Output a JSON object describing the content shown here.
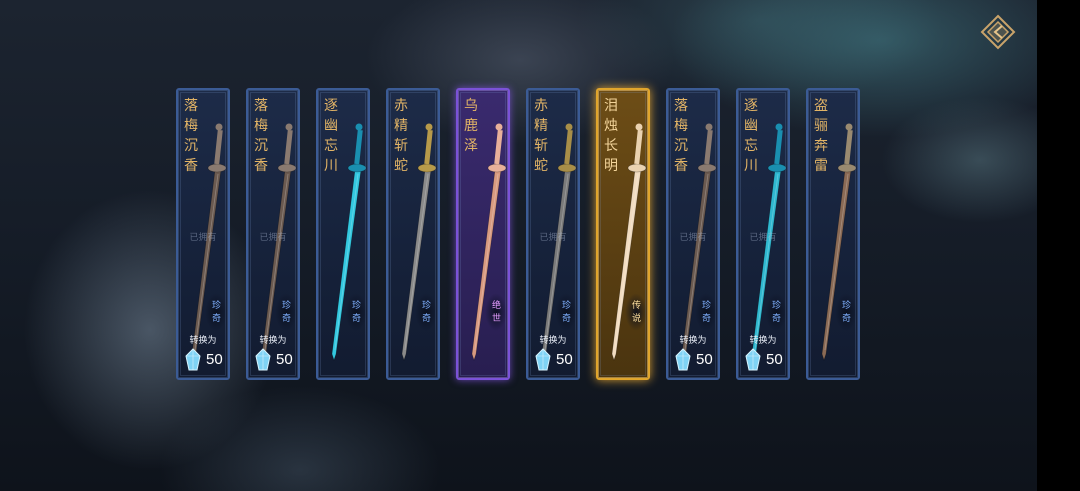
{
  "cards": [
    {
      "name": "落梅沉香",
      "owned": "已拥有",
      "rarity": "珍奇",
      "convert": "转换为",
      "cost": "50",
      "tier": "rare",
      "blade": "#6b5a50",
      "hilt": "#8a7a70"
    },
    {
      "name": "落梅沉香",
      "owned": "已拥有",
      "rarity": "珍奇",
      "convert": "转换为",
      "cost": "50",
      "tier": "rare",
      "blade": "#6b5a50",
      "hilt": "#8a7a70"
    },
    {
      "name": "逐幽忘川",
      "owned": "",
      "rarity": "珍奇",
      "convert": "",
      "cost": "",
      "tier": "rare",
      "blade": "#33c8e0",
      "hilt": "#1a8fb0"
    },
    {
      "name": "赤精斩蛇",
      "owned": "",
      "rarity": "珍奇",
      "convert": "",
      "cost": "",
      "tier": "rare",
      "blade": "#8a8a8a",
      "hilt": "#b79a4a"
    },
    {
      "name": "乌鹿泽",
      "owned": "",
      "rarity": "绝世",
      "convert": "",
      "cost": "",
      "tier": "epic",
      "blade": "#d89a80",
      "hilt": "#e8b09a"
    },
    {
      "name": "赤精斩蛇",
      "owned": "已拥有",
      "rarity": "珍奇",
      "convert": "转换为",
      "cost": "50",
      "tier": "rare",
      "blade": "#7a7a7a",
      "hilt": "#a88e48"
    },
    {
      "name": "泪烛长明",
      "owned": "",
      "rarity": "传说",
      "convert": "",
      "cost": "",
      "tier": "legend",
      "blade": "#f2dcc0",
      "hilt": "#ead2b0"
    },
    {
      "name": "落梅沉香",
      "owned": "已拥有",
      "rarity": "珍奇",
      "convert": "转换为",
      "cost": "50",
      "tier": "rare",
      "blade": "#6b5a50",
      "hilt": "#8a7a70"
    },
    {
      "name": "逐幽忘川",
      "owned": "已拥有",
      "rarity": "珍奇",
      "convert": "转换为",
      "cost": "50",
      "tier": "rare",
      "blade": "#2fb8d0",
      "hilt": "#1a8fb0"
    },
    {
      "name": "盗骊奔雷",
      "owned": "",
      "rarity": "珍奇",
      "convert": "",
      "cost": "",
      "tier": "rare",
      "blade": "#8a6a55",
      "hilt": "#9a8a70"
    }
  ],
  "icons": {
    "back": "back-diamond-icon",
    "currency": "crystal-icon"
  },
  "colors": {
    "rare_border": "#3b5b95",
    "epic_border": "#7b52d8",
    "legend_border": "#e0a52c",
    "name_gold": "#e2b466"
  }
}
